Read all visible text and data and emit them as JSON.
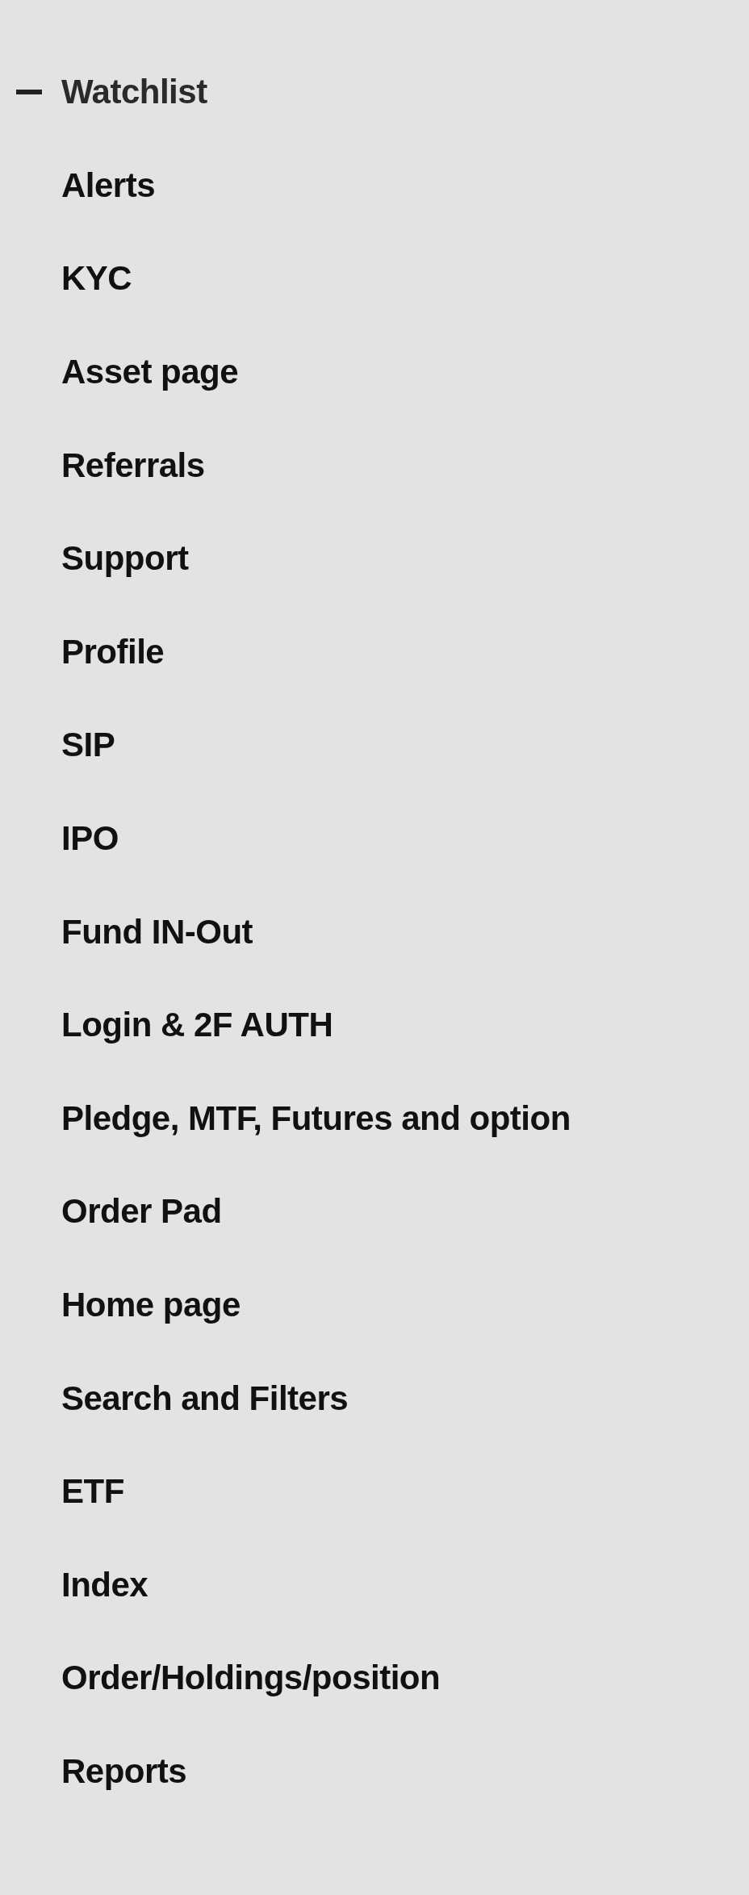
{
  "menu": {
    "items": [
      {
        "label": "Watchlist",
        "expanded": true
      },
      {
        "label": "Alerts"
      },
      {
        "label": "KYC"
      },
      {
        "label": "Asset page"
      },
      {
        "label": "Referrals"
      },
      {
        "label": "Support"
      },
      {
        "label": "Profile"
      },
      {
        "label": "SIP"
      },
      {
        "label": "IPO"
      },
      {
        "label": "Fund IN-Out"
      },
      {
        "label": "Login & 2F AUTH"
      },
      {
        "label": "Pledge, MTF, Futures and option"
      },
      {
        "label": "Order Pad"
      },
      {
        "label": "Home page"
      },
      {
        "label": "Search and Filters"
      },
      {
        "label": "ETF"
      },
      {
        "label": "Index"
      },
      {
        "label": "Order/Holdings/position"
      },
      {
        "label": "Reports"
      }
    ]
  }
}
